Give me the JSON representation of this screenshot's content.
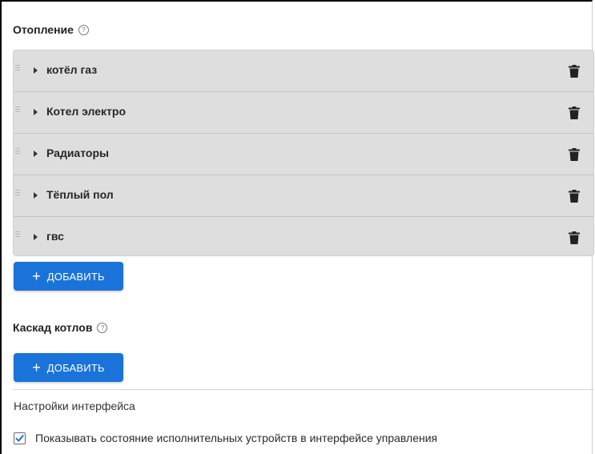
{
  "heating": {
    "title": "Отопление",
    "help_icon": "question-circle-icon",
    "items": [
      {
        "label": "котёл газ"
      },
      {
        "label": "Котел электро"
      },
      {
        "label": "Радиаторы"
      },
      {
        "label": "Тёплый пол"
      },
      {
        "label": "гвс"
      }
    ],
    "add_label": "ДОБАВИТЬ",
    "add_plus": "+"
  },
  "cascade": {
    "title": "Каскад котлов",
    "help_icon": "question-circle-icon",
    "add_label": "ДОБАВИТЬ",
    "add_plus": "+"
  },
  "interface": {
    "title": "Настройки интерфейса",
    "show_state": {
      "label": "Показывать состояние исполнительных устройств в интерфейсе управления",
      "checked": true
    }
  },
  "colors": {
    "accent": "#1a73d9",
    "list_background": "#dedede"
  }
}
